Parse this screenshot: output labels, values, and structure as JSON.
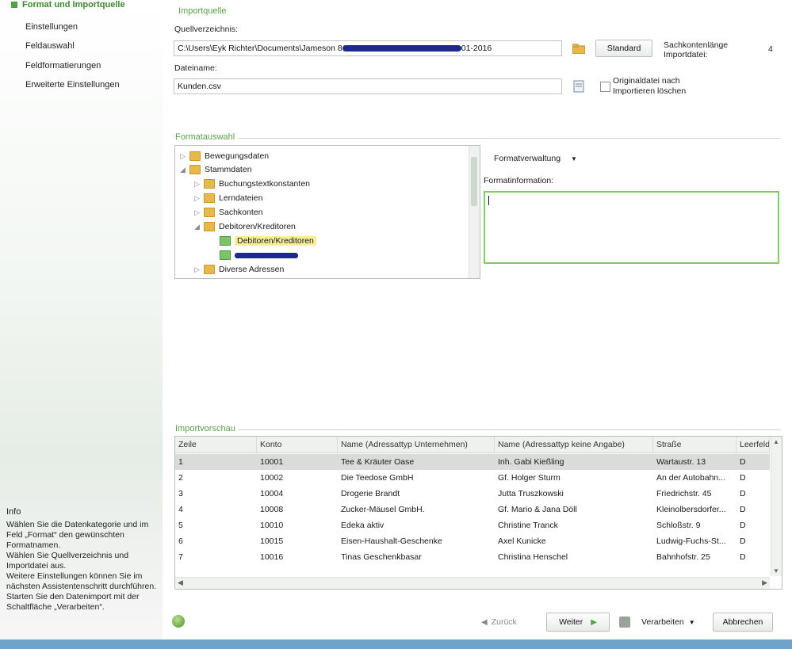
{
  "sidebar": {
    "items": [
      {
        "label": "Format und Importquelle",
        "active": true
      },
      {
        "label": "Einstellungen"
      },
      {
        "label": "Feldauswahl"
      },
      {
        "label": "Feldformatierungen"
      },
      {
        "label": "Erweiterte Einstellungen"
      }
    ],
    "info": {
      "title": "Info",
      "lines": [
        "Wählen Sie die Datenkategorie und im Feld „Format“ den gewünschten Formatnamen.",
        "Wählen Sie Quellverzeichnis und Importdatei aus.",
        "Weitere Einstellungen können Sie im nächsten Assistentenschritt durchführen.",
        "Starten Sie den Datenimport mit der Schaltfläche „Verarbeiten“."
      ]
    }
  },
  "importquelle": {
    "title": "Importquelle",
    "source_label": "Quellverzeichnis:",
    "source_value": "C:\\Users\\Eyk Richter\\Documents\\Jameson 8",
    "source_value_end": "01-2016",
    "standard_button": "Standard",
    "sachkonto_label": "Sachkontenlänge Importdatei:",
    "sachkonto_value": "4",
    "filename_label": "Dateiname:",
    "filename_value": "Kunden.csv",
    "delete_checkbox_label": "Originaldatei nach Importieren löschen",
    "delete_checked": false
  },
  "formatauswahl": {
    "title": "Formatauswahl",
    "tree": [
      {
        "label": "Bewegungsdaten",
        "level": 0,
        "expander": "▷",
        "icon": "folder"
      },
      {
        "label": "Stammdaten",
        "level": 0,
        "expander": "◢",
        "icon": "folder"
      },
      {
        "label": "Buchungstextkonstanten",
        "level": 1,
        "expander": "▷",
        "icon": "folder"
      },
      {
        "label": "Lerndateien",
        "level": 1,
        "expander": "▷",
        "icon": "folder"
      },
      {
        "label": "Sachkonten",
        "level": 1,
        "expander": "▷",
        "icon": "folder"
      },
      {
        "label": "Debitoren/Kreditoren",
        "level": 1,
        "expander": "◢",
        "icon": "folder"
      },
      {
        "label": "Debitoren/Kreditoren",
        "level": 2,
        "expander": "",
        "icon": "file",
        "selected": true
      },
      {
        "label": "",
        "level": 2,
        "expander": "",
        "icon": "file",
        "redacted": true
      },
      {
        "label": "Diverse Adressen",
        "level": 1,
        "expander": "▷",
        "icon": "folder"
      }
    ],
    "formatverwaltung_label": "Formatverwaltung",
    "formatinformation_label": "Formatinformation:"
  },
  "importvorschau": {
    "title": "Importvorschau",
    "columns": [
      "Zeile",
      "Konto",
      "Name (Adressattyp Unternehmen)",
      "Name (Adressattyp keine Angabe)",
      "Straße",
      "Leerfeld"
    ],
    "rows": [
      [
        "1",
        "10001",
        "Tee & Kräuter Oase",
        "Inh. Gabi Kießling",
        "Wartaustr. 13",
        "D"
      ],
      [
        "2",
        "10002",
        "Die Teedose GmbH",
        "Gf. Holger Sturm",
        "An der Autobahn...",
        "D"
      ],
      [
        "3",
        "10004",
        "Drogerie Brandt",
        "Jutta Truszkowski",
        "Friedrichstr. 45",
        "D"
      ],
      [
        "4",
        "10008",
        "Zucker-Mäusel GmbH.",
        "Gf. Mario & Jana Döll",
        "Kleinolbersdorfer...",
        "D"
      ],
      [
        "5",
        "10010",
        "Edeka aktiv",
        "Christine Tranck",
        "Schloßstr. 9",
        "D"
      ],
      [
        "6",
        "10015",
        "Eisen-Haushalt-Geschenke",
        "Axel Kunicke",
        "Ludwig-Fuchs-St...",
        "D"
      ],
      [
        "7",
        "10016",
        "Tinas Geschenkbasar",
        "Christina Henschel",
        "Bahnhofstr. 25",
        "D"
      ]
    ],
    "selected_row": 0
  },
  "footer": {
    "back": "Zurück",
    "next": "Weiter",
    "process": "Verarbeiten",
    "cancel": "Abbrechen"
  },
  "colors": {
    "accent": "#5aa04a",
    "active_nav": "#3a8a2a",
    "selection": "#f7ee9a",
    "taskbar": "#6fa3c9"
  }
}
